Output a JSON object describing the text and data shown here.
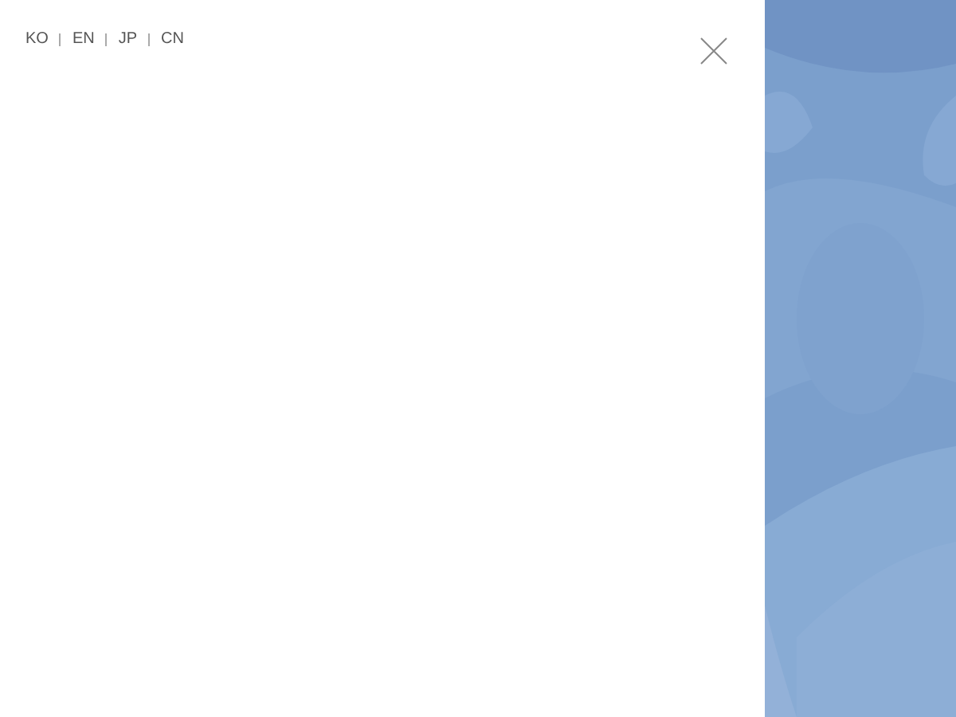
{
  "languages": [
    {
      "label": "KO"
    },
    {
      "label": "EN"
    },
    {
      "label": "JP"
    },
    {
      "label": "CN"
    }
  ]
}
